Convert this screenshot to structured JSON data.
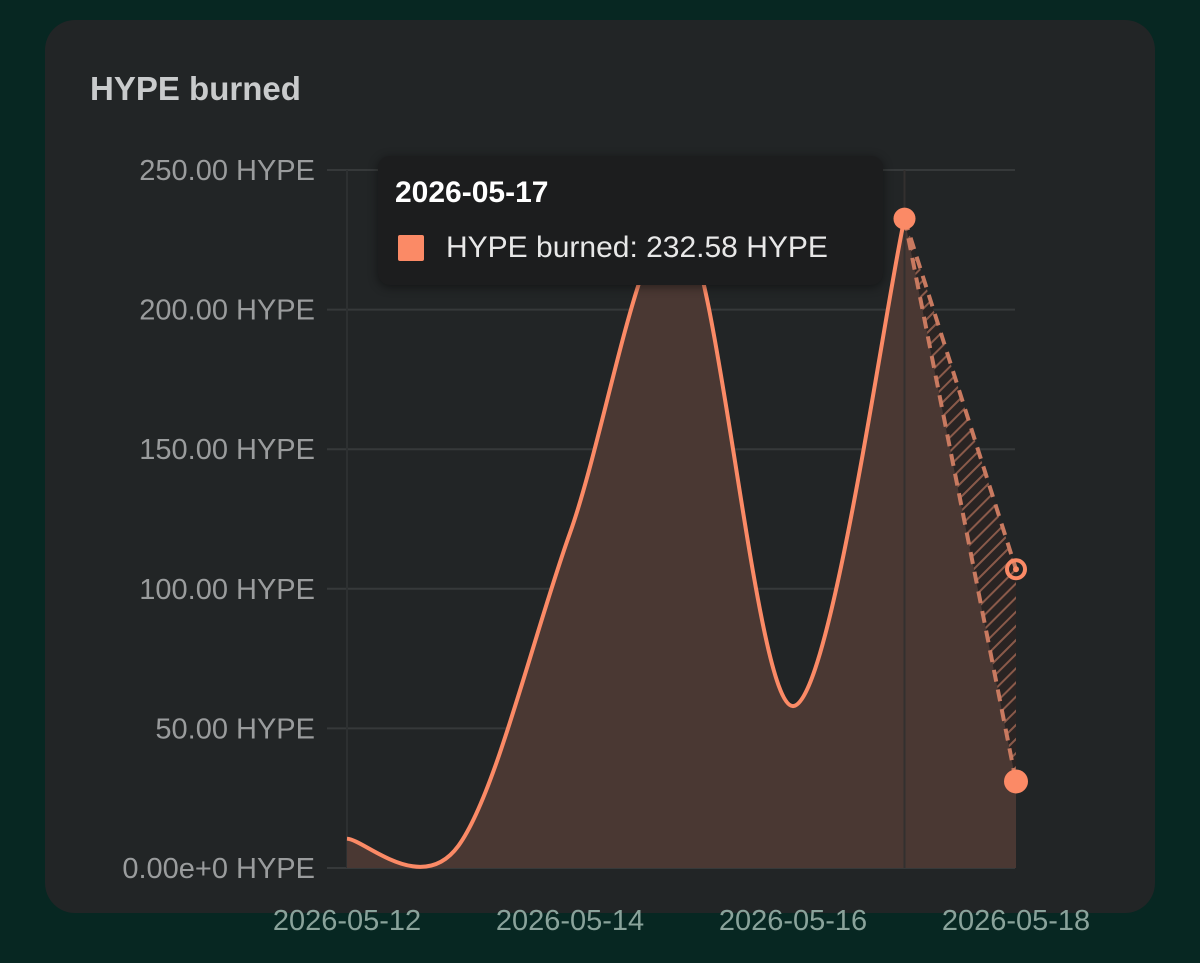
{
  "card": {
    "title": "HYPE burned"
  },
  "tooltip": {
    "date": "2026-05-17",
    "series_label": "HYPE burned",
    "value_text": "232.58 HYPE",
    "line": "HYPE burned: 232.58 HYPE"
  },
  "chart_data": {
    "type": "area",
    "title": "HYPE burned",
    "xlabel": "",
    "ylabel": "",
    "x": [
      "2026-05-12",
      "2026-05-13",
      "2026-05-14",
      "2026-05-15",
      "2026-05-16",
      "2026-05-17",
      "2026-05-18"
    ],
    "series": [
      {
        "values": [
          10.5,
          8,
          120,
          231,
          58,
          232.58,
          31
        ],
        "projected_value": 107,
        "projected_date": "2026-05-18"
      }
    ],
    "ylim": [
      0,
      250
    ],
    "y_ticks": [
      0,
      50,
      100,
      150,
      200,
      250
    ],
    "y_tick_labels": [
      "0.00e+0 HYPE",
      "50.00 HYPE",
      "100.00 HYPE",
      "150.00 HYPE",
      "200.00 HYPE",
      "250.00 HYPE"
    ],
    "x_ticks": [
      "2026-05-12",
      "2026-05-14",
      "2026-05-16",
      "2026-05-18"
    ],
    "highlighted_x": "2026-05-17",
    "grid": true,
    "colors": {
      "line": "#fb8a66",
      "area": "#4a3833",
      "grid": "#36393a"
    }
  }
}
